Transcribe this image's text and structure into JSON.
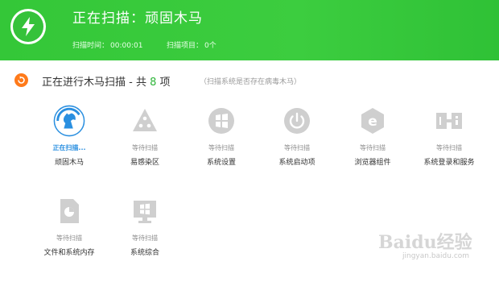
{
  "header": {
    "title": "正在扫描：顽固木马",
    "scan_time_label": "扫描时间：",
    "scan_time_value": "00:00:01",
    "scan_items_label": "扫描项目：",
    "scan_items_value": "0个",
    "logo_icon": "lightning-bolt-icon"
  },
  "section": {
    "title_prefix": "正在进行木马扫描 - 共 ",
    "count": "8",
    "title_suffix": " 项",
    "note": "（扫描系统是否存在病毒木马）",
    "icon": "arrow-circle-icon"
  },
  "items": [
    {
      "status": "正在扫描...",
      "name": "顽固木马",
      "icon": "horse-icon",
      "active": true
    },
    {
      "status": "等待扫描",
      "name": "易感染区",
      "icon": "triangle-icon",
      "active": false
    },
    {
      "status": "等待扫描",
      "name": "系统设置",
      "icon": "gear-icon",
      "active": false
    },
    {
      "status": "等待扫描",
      "name": "系统启动项",
      "icon": "power-icon",
      "active": false
    },
    {
      "status": "等待扫描",
      "name": "浏览器组件",
      "icon": "browser-e-icon",
      "active": false
    },
    {
      "status": "等待扫描",
      "name": "系统登录和服务",
      "icon": "service-icon",
      "active": false
    },
    {
      "status": "等待扫描",
      "name": "文件和系统内存",
      "icon": "file-icon",
      "active": false
    },
    {
      "status": "等待扫描",
      "name": "系统综合",
      "icon": "monitor-icon",
      "active": false
    }
  ],
  "watermark": {
    "main": "Baidu经验",
    "sub": "jingyan.baidu.com"
  },
  "colors": {
    "header_green": "#35c63b",
    "active_blue": "#2a8fe0",
    "icon_gray": "#cfcfcf",
    "count_green": "#2fb53a",
    "section_orange": "#ff7a1a"
  }
}
